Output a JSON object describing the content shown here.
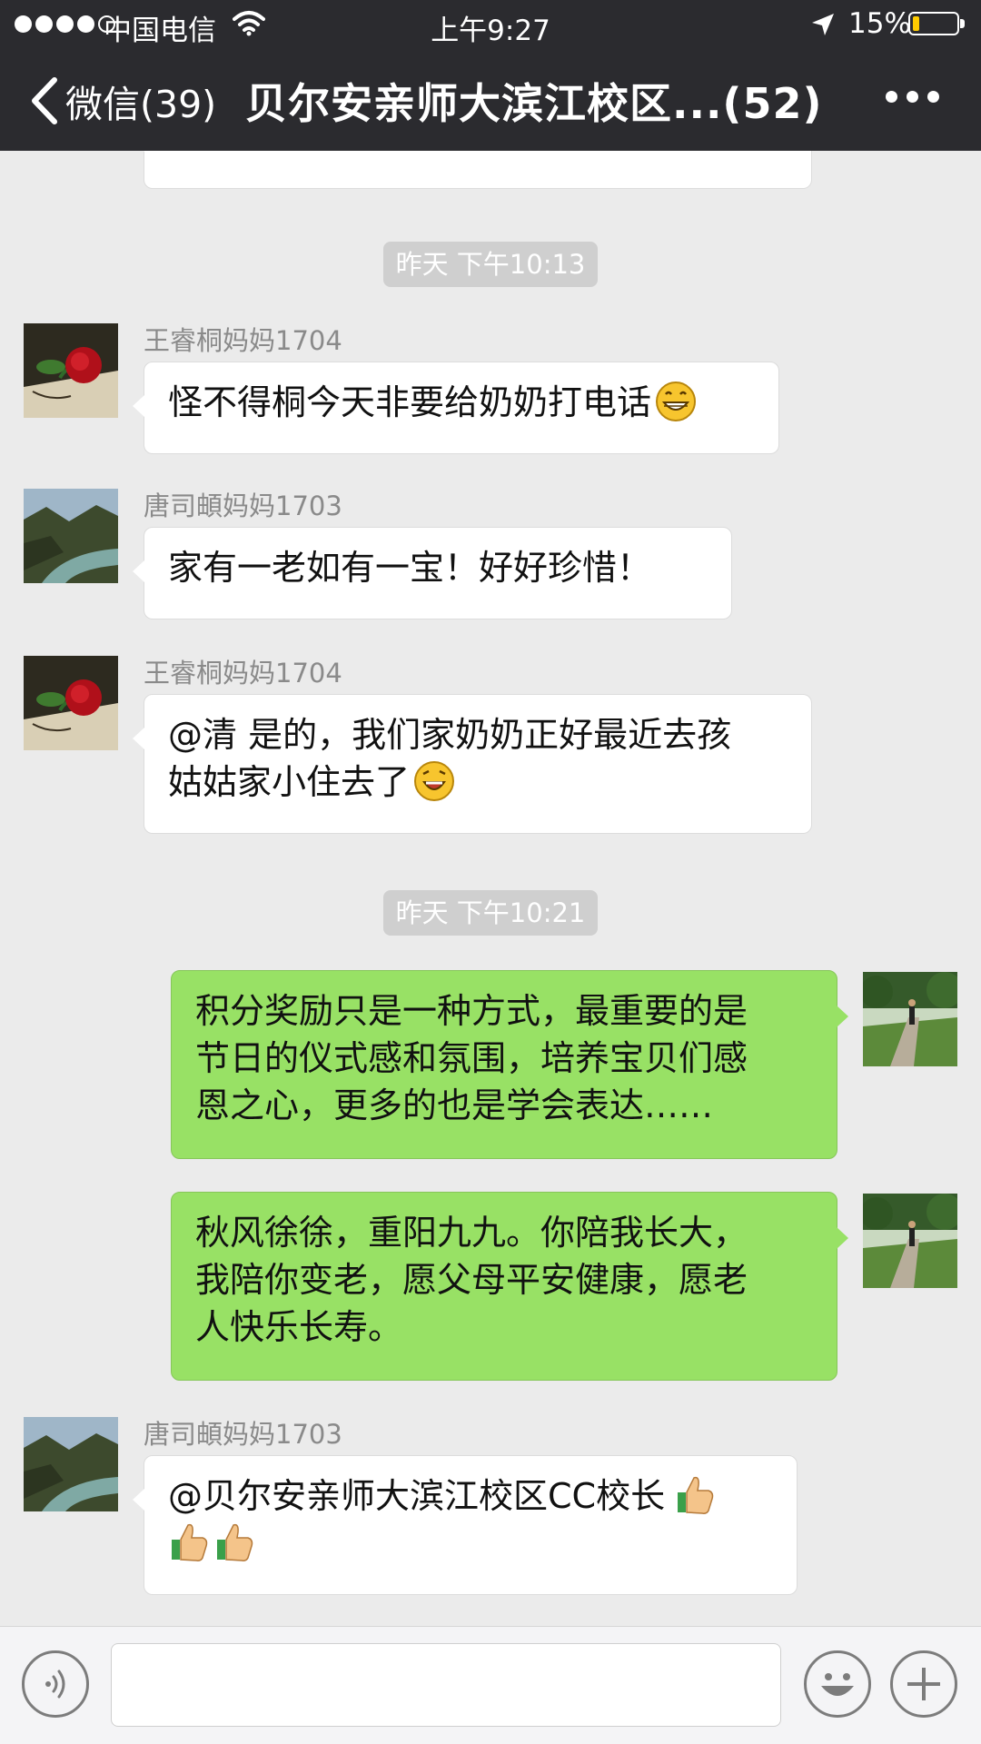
{
  "status_bar": {
    "carrier": "中国电信",
    "time": "上午9:27",
    "battery_percent_text": "15%",
    "battery_level": 0.15
  },
  "nav": {
    "back_label": "微信(39)",
    "title": "贝尔安亲师大滨江校区...(52)"
  },
  "messages": {
    "timestamp1": "昨天  下午10:13",
    "m1": {
      "sender": "王睿桐妈妈1704",
      "text": "怪不得桐今天非要给奶奶打电话"
    },
    "m2": {
      "sender": "唐司頔妈妈1703",
      "text": "家有一老如有一宝！好好珍惜！"
    },
    "m3": {
      "sender": "王睿桐妈妈1704",
      "text_line1": "@清 是的，我们家奶奶正好最近去孩",
      "text_line2": "姑姑家小住去了"
    },
    "timestamp2": "昨天  下午10:21",
    "m4": {
      "line1": "积分奖励只是一种方式，最重要的是",
      "line2": "节日的仪式感和氛围，培养宝贝们感",
      "line3": "恩之心，更多的也是学会表达……"
    },
    "m5": {
      "line1": "秋风徐徐，重阳九九。你陪我长大，",
      "line2": "我陪你变老，愿父母平安健康，愿老",
      "line3": "人快乐长寿。"
    },
    "m6": {
      "sender": "唐司頔妈妈1703",
      "text": "@贝尔安亲师大滨江校区CC校长"
    }
  },
  "icons": {
    "back": "chevron-left-icon",
    "more": "more-dots-icon",
    "voice": "voice-icon",
    "emoji": "emoji-face-icon",
    "add": "plus-icon"
  },
  "colors": {
    "topbar": "#2b2b2f",
    "chat_background": "#ebebeb",
    "own_bubble": "#98e165",
    "other_bubble": "#ffffff",
    "battery": "#ffcc00"
  }
}
